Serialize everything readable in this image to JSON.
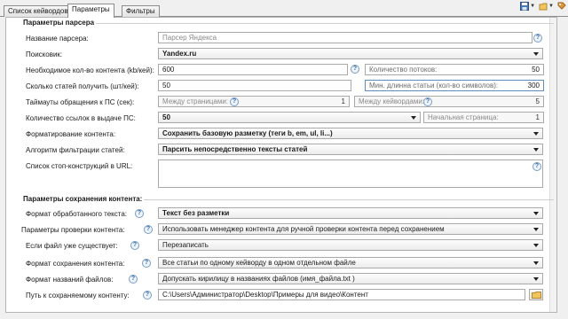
{
  "tabs": [
    {
      "label": "Список кейвордов"
    },
    {
      "label": "Параметры"
    },
    {
      "label": "Фильтры"
    }
  ],
  "parser_section": {
    "title": "Параметры парсера",
    "parser_name": {
      "label": "Название парсера:",
      "placeholder": "Парсер Яндекса"
    },
    "search_engine": {
      "label": "Поисковик:",
      "value": "Yandex.ru"
    },
    "content_needed": {
      "label": "Необходимое кол-во контента (kb/кей):",
      "value": "600"
    },
    "threads": {
      "label": "Количество потоков:",
      "value": "50"
    },
    "articles_count": {
      "label": "Сколько статей получить (шт/кей):",
      "value": "50"
    },
    "min_article_length": {
      "label": "Мин. длинна статьи (кол-во символов):",
      "value": "300"
    },
    "timeouts": {
      "label": "Таймауты обращения к ПС (сек):"
    },
    "between_pages": {
      "label": "Между страницами:",
      "value": "1"
    },
    "between_keywords": {
      "label": "Между кейвордами:",
      "value": "5"
    },
    "links_count": {
      "label": "Количество ссылок в выдаче ПС:",
      "value": "50"
    },
    "start_page": {
      "label": "Начальная страница:",
      "value": "1"
    },
    "formatting": {
      "label": "Форматирование контента:",
      "value": "Сохранить базовую разметку (теги b, em, ul, li...)"
    },
    "filter_algorithm": {
      "label": "Алгоритм фильтрации статей:",
      "value": "Парсить непосредственно тексты статей"
    },
    "stop_list": {
      "label": "Список стоп-конструкций в URL:"
    }
  },
  "save_section": {
    "title": "Параметры сохранения контента:",
    "text_format": {
      "label": "Формат обработанного текста:",
      "value": "Текст без разметки"
    },
    "check_params": {
      "label": "Параметры проверки контента:",
      "value": "Использовать менеджер контента для ручной проверки контента перед сохранением"
    },
    "file_exists": {
      "label": "Если файл уже существует:",
      "value": "Перезаписать"
    },
    "save_format": {
      "label": "Формат сохранения контента:",
      "value": "Все статьи по одному кейворду в одном отдельном файле"
    },
    "file_names_format": {
      "label": "Формат названий файлов:",
      "value": "Допускать кирилицу в названиях файлов (имя_файла.txt )"
    },
    "save_path": {
      "label": "Путь к сохраняемому контенту:",
      "value": "C:\\Users\\Администратор\\Desktop\\Примеры для видео\\Контент"
    }
  },
  "help_symbol": "?",
  "colors": {
    "accent": "#3a6ea5",
    "border": "#a9a9a9",
    "panel": "#ffffff",
    "window": "#f0f0f0"
  }
}
